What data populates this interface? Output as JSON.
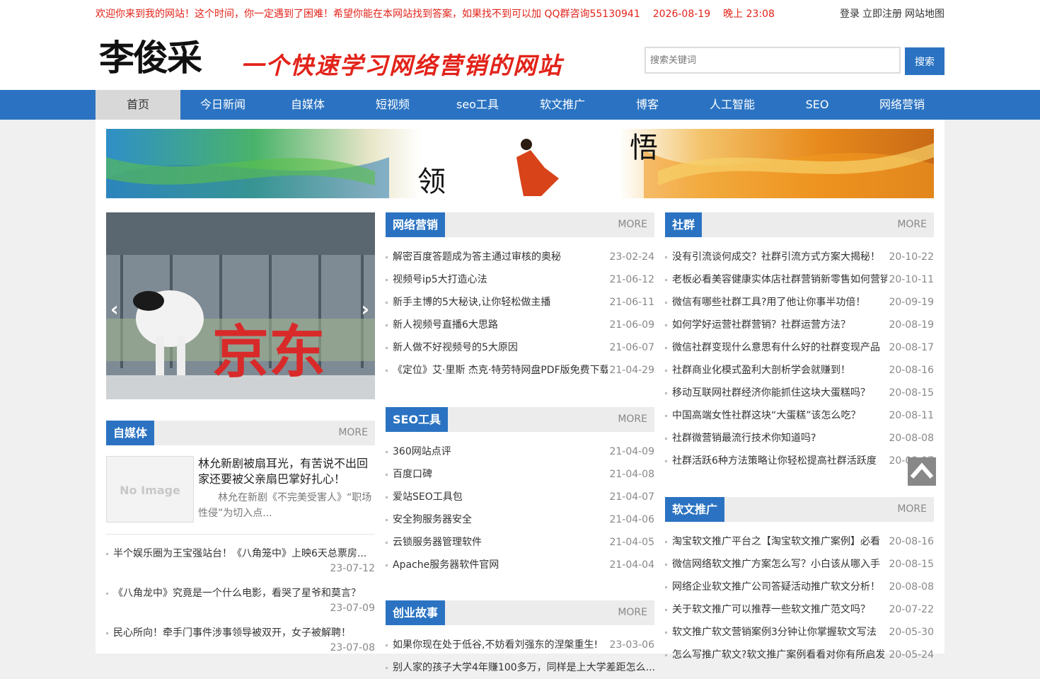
{
  "topbar": {
    "welcome": "欢迎你来到我的网站！这个时间，你一定遇到了困难！希望你能在本网站找到答案，如果找不到可以加 QQ群咨询55130941",
    "date": "2026-08-19",
    "time": "晚上  23:08",
    "login": "登录",
    "register": "立即注册",
    "sitemap": "网站地图"
  },
  "header": {
    "logo_text": "李俊采",
    "slogan": "一个快速学习网络营销的网站",
    "search_placeholder": "搜索关键词",
    "search_button": "搜索"
  },
  "nav": [
    "首页",
    "今日新闻",
    "自媒体",
    "短视频",
    "seo工具",
    "软文推广",
    "博客",
    "人工智能",
    "SEO",
    "网络营销"
  ],
  "banner": {
    "left_char": "领",
    "right_char": "悟"
  },
  "slider": {
    "text": "京东"
  },
  "more_label": "MORE",
  "wangluo": {
    "title": "网络营销",
    "items": [
      {
        "t": "解密百度答题成为答主通过审核的奥秘",
        "d": "23-02-24"
      },
      {
        "t": "视频号ip5大打造心法",
        "d": "21-06-12"
      },
      {
        "t": "新手主博的5大秘诀,让你轻松做主播",
        "d": "21-06-11"
      },
      {
        "t": "新人视频号直播6大思路",
        "d": "21-06-09"
      },
      {
        "t": "新人做不好视频号的5大原因",
        "d": "21-06-07"
      },
      {
        "t": "《定位》艾·里斯 杰克·特劳特网盘PDF版免费下载",
        "d": "21-04-29"
      }
    ]
  },
  "seotools": {
    "title": "SEO工具",
    "items": [
      {
        "t": "360网站点评",
        "d": "21-04-09"
      },
      {
        "t": "百度口碑",
        "d": "21-04-08"
      },
      {
        "t": "爱站SEO工具包",
        "d": "21-04-07"
      },
      {
        "t": "安全狗服务器安全",
        "d": "21-04-06"
      },
      {
        "t": "云锁服务器管理软件",
        "d": "21-04-05"
      },
      {
        "t": "Apache服务器软件官网",
        "d": "21-04-04"
      }
    ]
  },
  "chuangye": {
    "title": "创业故事",
    "items": [
      {
        "t": "如果你现在处于低谷,不妨看刘强东的涅槃重生!",
        "d": "23-03-06"
      },
      {
        "t": "别人家的孩子大学4年赚100多万，同样是上大学差距怎么...",
        "d": ""
      }
    ]
  },
  "shequn": {
    "title": "社群",
    "items": [
      {
        "t": "没有引流谈何成交？社群引流方式方案大揭秘！",
        "d": "20-10-22"
      },
      {
        "t": "老板必看美容健康实体店社群营销新零售如何营销",
        "d": "20-10-11"
      },
      {
        "t": "微信有哪些社群工具?用了他让你事半功倍！",
        "d": "20-09-19"
      },
      {
        "t": "如何学好运营社群营销？社群运营方法？",
        "d": "20-08-19"
      },
      {
        "t": "微信社群变现什么意思有什么好的社群变现产品",
        "d": "20-08-17"
      },
      {
        "t": "社群商业化模式盈利大剖析学会就赚到！",
        "d": "20-08-16"
      },
      {
        "t": "移动互联网社群经济你能抓住这块大蛋糕吗？",
        "d": "20-08-15"
      },
      {
        "t": "中国高端女性社群这块“大蛋糕”该怎么吃？",
        "d": "20-08-11"
      },
      {
        "t": "社群微营销最流行技术你知道吗?",
        "d": "20-08-08"
      },
      {
        "t": "社群活跃6种方法策略让你轻松提高社群活跃度",
        "d": "20-08-07"
      }
    ]
  },
  "ruanwen": {
    "title": "软文推广",
    "items": [
      {
        "t": "淘宝软文推广平台之【淘宝软文推广案例】必看",
        "d": "20-08-16"
      },
      {
        "t": "微信网络软文推广方案怎么写？小白该从哪入手",
        "d": "20-08-15"
      },
      {
        "t": "网络企业软文推广公司答疑活动推广软文分析！",
        "d": "20-08-08"
      },
      {
        "t": "关于软文推广可以推荐一些软文推广范文吗？",
        "d": "20-07-22"
      },
      {
        "t": "软文推广软文营销案例3分钟让你掌握软文写法",
        "d": "20-05-30"
      },
      {
        "t": "怎么写推广软文?软文推广案例看看对你有所启发",
        "d": "20-05-24"
      }
    ]
  },
  "zimeiti": {
    "title": "自媒体",
    "feature_title": "林允新剧被扇耳光，有苦说不出回家还要被父亲扇巴掌好扎心！",
    "feature_desc": "林允在新剧《不完美受害人》“职场性侵”为切入点...",
    "noimage": "No Image",
    "items": [
      {
        "t": "半个娱乐圈为王宝强站台！《八角笼中》上映6天总票房...",
        "d": "23-07-12"
      },
      {
        "t": "《八角龙中》究竟是一个什么电影，看哭了星爷和莫言？",
        "d": "23-07-09"
      },
      {
        "t": "民心所向！牵手门事件涉事领导被双开，女子被解聘！",
        "d": "23-07-08"
      }
    ]
  },
  "colors": {
    "accent": "#2b73c2",
    "red": "#e2231a"
  }
}
